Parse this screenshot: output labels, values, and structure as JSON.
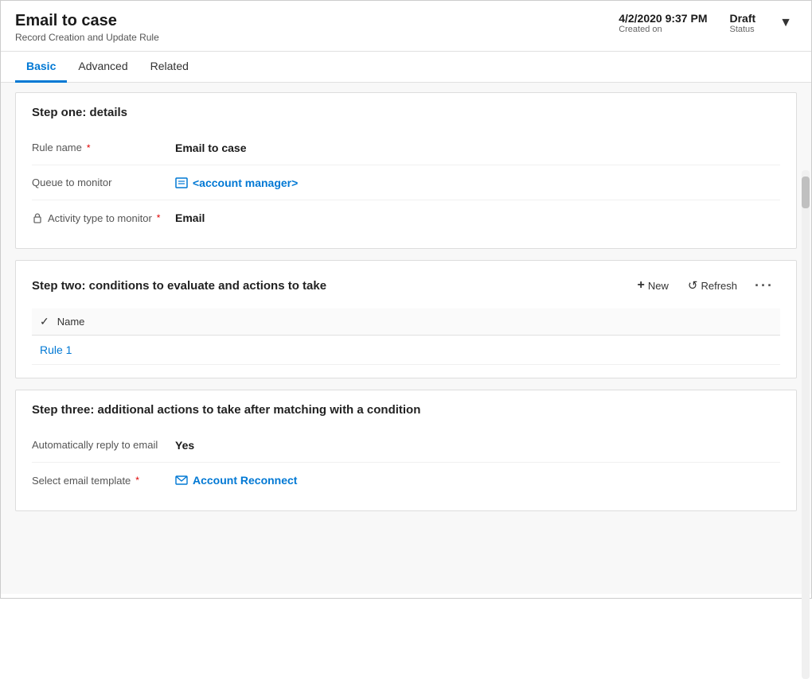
{
  "header": {
    "title": "Email to case",
    "subtitle": "Record Creation and Update Rule",
    "created_on_label": "Created on",
    "created_on_value": "4/2/2020 9:37 PM",
    "status_label": "Status",
    "status_value": "Draft"
  },
  "tabs": [
    {
      "id": "basic",
      "label": "Basic",
      "active": true
    },
    {
      "id": "advanced",
      "label": "Advanced",
      "active": false
    },
    {
      "id": "related",
      "label": "Related",
      "active": false
    }
  ],
  "step_one": {
    "title": "Step one: details",
    "fields": {
      "rule_name_label": "Rule name",
      "rule_name_value": "Email to case",
      "queue_label": "Queue to monitor",
      "queue_value": "<account manager>",
      "activity_label": "Activity type to monitor",
      "activity_value": "Email"
    }
  },
  "step_two": {
    "title": "Step two: conditions to evaluate and actions to take",
    "toolbar": {
      "new_label": "New",
      "refresh_label": "Refresh"
    },
    "table": {
      "col_name": "Name",
      "rows": [
        {
          "name": "Rule 1"
        }
      ]
    }
  },
  "step_three": {
    "title": "Step three: additional actions to take after matching with a condition",
    "fields": {
      "auto_reply_label": "Automatically reply to email",
      "auto_reply_value": "Yes",
      "email_template_label": "Select email template",
      "email_template_value": "Account Reconnect"
    }
  },
  "icons": {
    "queue": "📋",
    "lock": "🔒",
    "template": "📧",
    "plus": "+",
    "refresh_symbol": "↺",
    "chevron_down": "▾",
    "checkmark": "✓",
    "more_dots": "···"
  }
}
